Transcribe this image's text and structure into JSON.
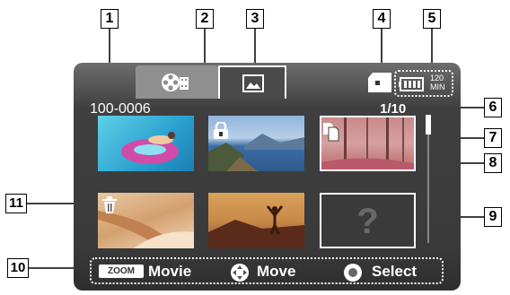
{
  "callouts": [
    "1",
    "2",
    "3",
    "4",
    "5",
    "6",
    "7",
    "8",
    "9",
    "10",
    "11"
  ],
  "header": {
    "folder_number": "100-0006",
    "page_indicator": "1/10"
  },
  "tabs": [
    {
      "name": "video",
      "icon": "film-reel-icon"
    },
    {
      "name": "photo",
      "icon": "photo-icon"
    }
  ],
  "status": {
    "storage_icon": "memory-card-icon",
    "battery_icon": "battery-icon",
    "battery_time_value": "120",
    "battery_time_unit": "MIN"
  },
  "thumbnails": [
    {
      "id": "pool",
      "overlay_icon": ""
    },
    {
      "id": "lake",
      "overlay_icon": "lock-icon"
    },
    {
      "id": "forest",
      "overlay_icon": "copy-icon"
    },
    {
      "id": "sand",
      "overlay_icon": "trash-icon"
    },
    {
      "id": "sunset",
      "overlay_icon": ""
    },
    {
      "id": "unknown",
      "overlay_icon": "question-mark",
      "label": "?"
    }
  ],
  "bottom_bar": {
    "zoom_label": "ZOOM",
    "movie_label": "Movie",
    "move_label": "Move",
    "select_label": "Select"
  },
  "colors": {
    "screen": "#3a3a3a",
    "tab_active_border": "#ffffff",
    "text": "#ffffff"
  }
}
